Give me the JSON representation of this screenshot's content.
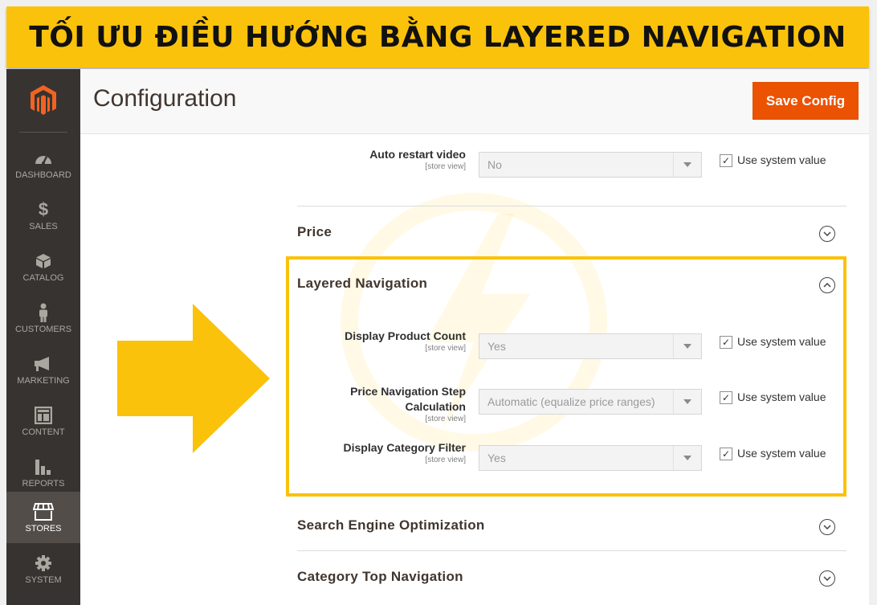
{
  "banner": {
    "title": "TỐI ƯU ĐIỀU HƯỚNG BẰNG LAYERED NAVIGATION"
  },
  "sidebar": {
    "items": [
      {
        "label": "DASHBOARD",
        "icon": "dashboard-icon"
      },
      {
        "label": "SALES",
        "icon": "dollar-icon"
      },
      {
        "label": "CATALOG",
        "icon": "cube-icon"
      },
      {
        "label": "CUSTOMERS",
        "icon": "person-icon"
      },
      {
        "label": "MARKETING",
        "icon": "megaphone-icon"
      },
      {
        "label": "CONTENT",
        "icon": "layout-icon"
      },
      {
        "label": "REPORTS",
        "icon": "bar-chart-icon"
      },
      {
        "label": "STORES",
        "icon": "store-icon"
      },
      {
        "label": "SYSTEM",
        "icon": "gear-icon"
      }
    ],
    "active": "STORES"
  },
  "header": {
    "title": "Configuration",
    "save_label": "Save Config"
  },
  "fields": {
    "auto_restart": {
      "label": "Auto restart video",
      "scope": "[store view]",
      "value": "No",
      "checkbox": "Use system value"
    },
    "display_count": {
      "label": "Display Product Count",
      "scope": "[store view]",
      "value": "Yes",
      "checkbox": "Use system value"
    },
    "price_step": {
      "label": "Price Navigation Step Calculation",
      "scope": "[store view]",
      "value": "Automatic (equalize price ranges)",
      "checkbox": "Use system value"
    },
    "category_filter": {
      "label": "Display Category Filter",
      "scope": "[store view]",
      "value": "Yes",
      "checkbox": "Use system value"
    }
  },
  "sections": {
    "price": "Price",
    "layered": "Layered Navigation",
    "seo": "Search Engine Optimization",
    "category_top": "Category Top Navigation"
  },
  "colors": {
    "accent": "#fbc20b",
    "save": "#eb5202",
    "sidebar": "#373330"
  }
}
